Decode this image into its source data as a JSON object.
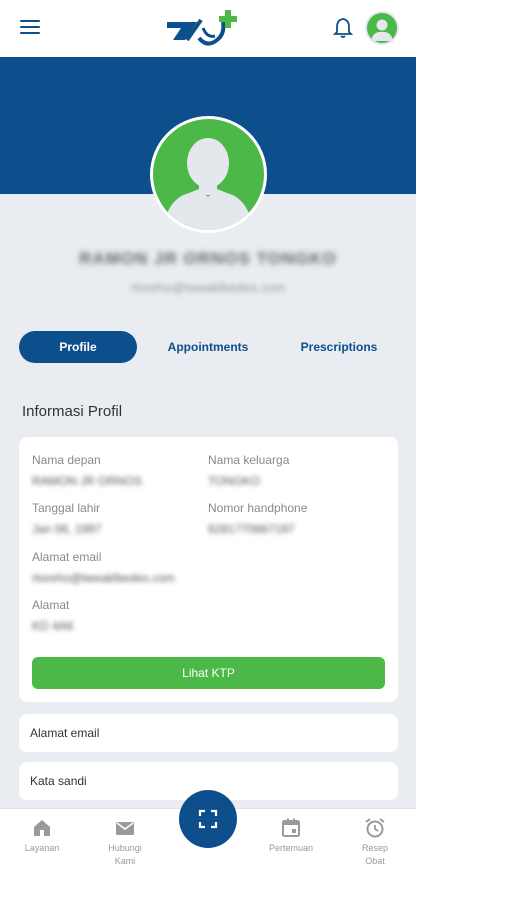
{
  "header": {
    "menu_icon": "menu-icon",
    "logo": "brand-logo",
    "bell_icon": "bell-icon",
    "avatar_icon": "user-avatar-icon"
  },
  "profile": {
    "name": "RAMON JR ORNOS TONGKO",
    "email": "rtoreho@tweaklbedes.com"
  },
  "tabs": [
    {
      "label": "Profile",
      "active": true
    },
    {
      "label": "Appointments",
      "active": false
    },
    {
      "label": "Prescriptions",
      "active": false
    }
  ],
  "section": {
    "title": "Informasi Profil"
  },
  "info": {
    "first_name_label": "Nama depan",
    "first_name_value": "RAMON JR ORNOS",
    "last_name_label": "Nama keluarga",
    "last_name_value": "TONGKO",
    "birthdate_label": "Tanggal lahir",
    "birthdate_value": "Jan 06, 1997",
    "phone_label": "Nomor handphone",
    "phone_value": "6281770667197",
    "email_label": "Alamat email",
    "email_value": "rtoreho@tweaklbedes.com",
    "address_label": "Alamat",
    "address_value": "KD 4A6",
    "ktp_button": "Lihat KTP"
  },
  "settings_rows": [
    {
      "label": "Alamat email"
    },
    {
      "label": "Kata sandi"
    }
  ],
  "bottom_nav": [
    {
      "label": "Layanan",
      "icon": "home-icon"
    },
    {
      "label": "Hubungi Kami",
      "icon": "mail-icon"
    },
    {
      "label": "Pertemuan",
      "icon": "calendar-icon"
    },
    {
      "label": "Resep Obat",
      "icon": "alarm-clock-icon"
    }
  ],
  "fab": {
    "icon": "scan-icon"
  },
  "colors": {
    "primary": "#0d4f8c",
    "accent": "#4cb847",
    "background": "#e9edf2"
  }
}
